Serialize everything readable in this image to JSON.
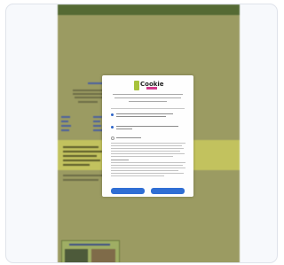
{
  "site": {
    "top_nav_text": "",
    "thumbnail_caption": ""
  },
  "consent": {
    "logo_text": "Cookie",
    "heading": "",
    "options": [
      {
        "label": "",
        "checked": true
      },
      {
        "label": "",
        "checked": true
      },
      {
        "label": "",
        "checked": false
      }
    ],
    "accept_label": "",
    "settings_label": ""
  }
}
